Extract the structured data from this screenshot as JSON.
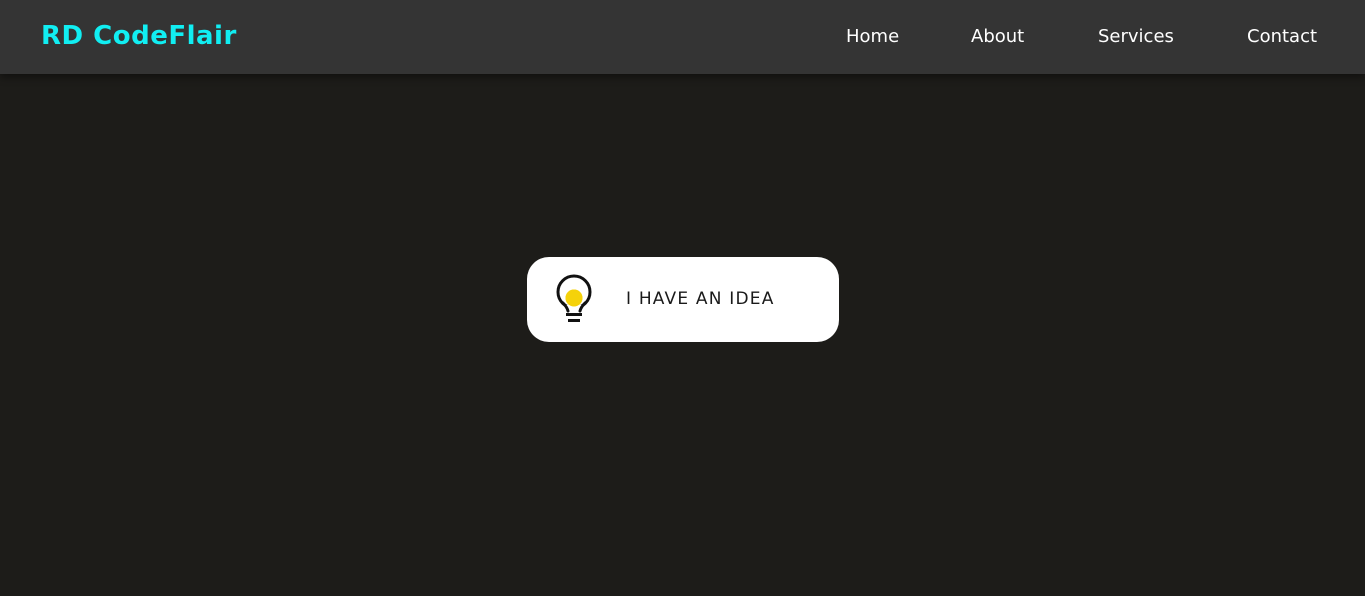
{
  "brand": {
    "name": "RD CodeFlair",
    "color": "#11eef2"
  },
  "nav": {
    "items": [
      {
        "label": "Home"
      },
      {
        "label": "About"
      },
      {
        "label": "Services"
      },
      {
        "label": "Contact"
      }
    ]
  },
  "cta": {
    "label": "I HAVE AN IDEA",
    "icon": "lightbulb-icon",
    "bulb_color": "#f5d20a"
  },
  "colors": {
    "background": "#1d1c19",
    "navbar": "#343434",
    "nav_text": "#ffffff",
    "button_bg": "#ffffff"
  }
}
